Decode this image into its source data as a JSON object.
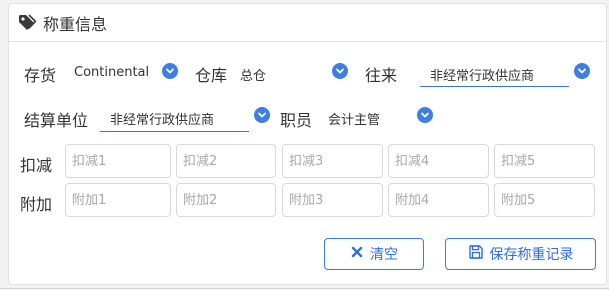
{
  "panel": {
    "title": "称重信息",
    "title_icon": "tag-icon"
  },
  "row1": {
    "stock": {
      "label": "存货",
      "value": "Continental"
    },
    "warehouse": {
      "label": "仓库",
      "value": "总仓"
    },
    "partner": {
      "label": "往来",
      "value": "非经常行政供应商"
    }
  },
  "row2": {
    "settlement": {
      "label": "结算单位",
      "value": "非经常行政供应商"
    },
    "staff": {
      "label": "职员",
      "value": "会计主管"
    }
  },
  "deductions": {
    "label": "扣减",
    "placeholders": [
      "扣减1",
      "扣减2",
      "扣减3",
      "扣减4",
      "扣减5"
    ]
  },
  "additions": {
    "label": "附加",
    "placeholders": [
      "附加1",
      "附加2",
      "附加3",
      "附加4",
      "附加5"
    ]
  },
  "actions": {
    "clear_label": "清空",
    "save_label": "保存称重记录"
  },
  "colors": {
    "accent": "#3f7fe0",
    "border": "#d9d9d9"
  }
}
